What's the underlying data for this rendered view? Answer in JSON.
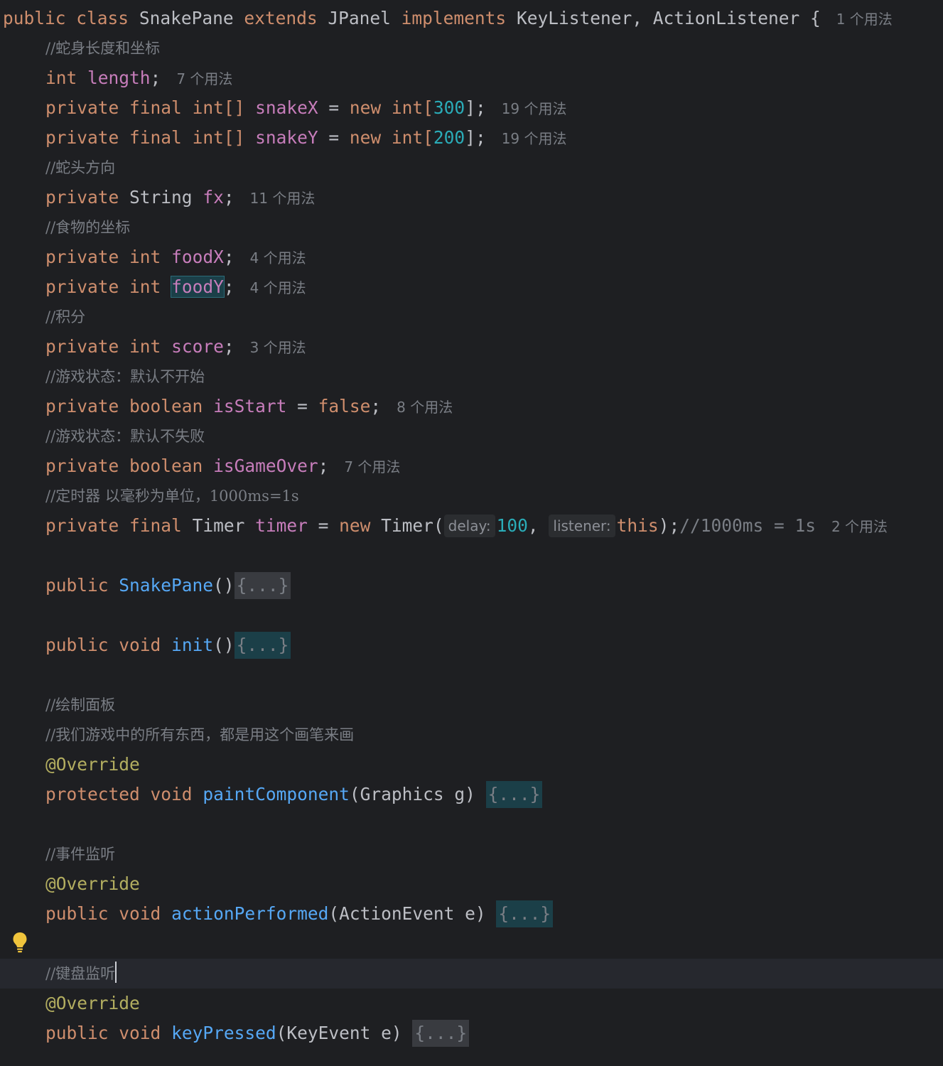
{
  "editor": {
    "lines": {
      "l1": {
        "public": "public",
        "class": "class",
        "name": "SnakePane",
        "extends": "extends",
        "parent": "JPanel",
        "implements": "implements",
        "ifaces": "KeyListener, ActionListener {",
        "usage": "1 个用法"
      },
      "l2": {
        "comment": "//蛇身长度和坐标"
      },
      "l3": {
        "type": "int",
        "field": "length",
        "end": ";",
        "usage": "7 个用法"
      },
      "l4": {
        "private": "private",
        "final": "final",
        "type": "int[]",
        "field": "snakeX",
        "eq": " = ",
        "new": "new",
        "ctype": "int[",
        "num": "300",
        "end": "];",
        "usage": "19 个用法"
      },
      "l5": {
        "private": "private",
        "final": "final",
        "type": "int[]",
        "field": "snakeY",
        "eq": " = ",
        "new": "new",
        "ctype": "int[",
        "num": "200",
        "end": "];",
        "usage": "19 个用法"
      },
      "l6": {
        "comment": "//蛇头方向"
      },
      "l7": {
        "private": "private",
        "type": "String",
        "field": "fx",
        "end": ";",
        "usage": "11 个用法"
      },
      "l8": {
        "comment": "//食物的坐标"
      },
      "l9": {
        "private": "private",
        "type": "int",
        "field": "foodX",
        "end": ";",
        "usage": "4 个用法"
      },
      "l10": {
        "private": "private",
        "type": "int",
        "field": "foodY",
        "end": ";",
        "usage": "4 个用法"
      },
      "l11": {
        "comment": "//积分"
      },
      "l12": {
        "private": "private",
        "type": "int",
        "field": "score",
        "end": ";",
        "usage": "3 个用法"
      },
      "l13": {
        "comment": "//游戏状态：默认不开始"
      },
      "l14": {
        "private": "private",
        "type": "boolean",
        "field": "isStart",
        "eq": " = ",
        "value": "false",
        "end": ";",
        "usage": "8 个用法"
      },
      "l15": {
        "comment": "//游戏状态：默认不失败"
      },
      "l16": {
        "private": "private",
        "type": "boolean",
        "field": "isGameOver",
        "end": ";",
        "usage": "7 个用法"
      },
      "l17": {
        "comment": "//定时器 以毫秒为单位，1000ms=1s"
      },
      "l18": {
        "private": "private",
        "final": "final",
        "type": "Timer",
        "field": "timer",
        "eq": " = ",
        "new": "new",
        "ctor": "Timer(",
        "hint1": "delay:",
        "num": "100",
        "comma": ", ",
        "hint2": "listener:",
        "this": "this",
        "end": ");",
        "comment": "//1000ms = 1s",
        "usage": "2 个用法"
      },
      "l20": {
        "public": "public",
        "method": "SnakePane",
        "parens": "()",
        "fold": "{...}"
      },
      "l22": {
        "public": "public",
        "void": "void",
        "method": "init",
        "parens": "()",
        "fold": "{...}"
      },
      "l24": {
        "comment": "//绘制面板"
      },
      "l25": {
        "comment": "//我们游戏中的所有东西，都是用这个画笔来画"
      },
      "l26": {
        "annotation": "@Override"
      },
      "l27": {
        "protected": "protected",
        "void": "void",
        "method": "paintComponent",
        "params": "(Graphics g) ",
        "fold": "{...}"
      },
      "l29": {
        "comment": "//事件监听"
      },
      "l30": {
        "annotation": "@Override"
      },
      "l31": {
        "public": "public",
        "void": "void",
        "method": "actionPerformed",
        "params": "(ActionEvent e) ",
        "fold": "{...}"
      },
      "l33": {
        "comment": "//键盘监听"
      },
      "l34": {
        "annotation": "@Override"
      },
      "l35": {
        "public": "public",
        "void": "void",
        "method": "keyPressed",
        "params": "(KeyEvent e) ",
        "fold": "{...}"
      }
    },
    "gutter": {
      "bulb_icon": "lightbulb-icon"
    },
    "colors": {
      "background": "#1e1f22",
      "keyword": "#cf8e6d",
      "field": "#c77dbb",
      "number": "#2aacb8",
      "method": "#56a8f5",
      "annotation": "#b3ae60",
      "comment": "#7a7e85",
      "text": "#bcbec4"
    }
  }
}
